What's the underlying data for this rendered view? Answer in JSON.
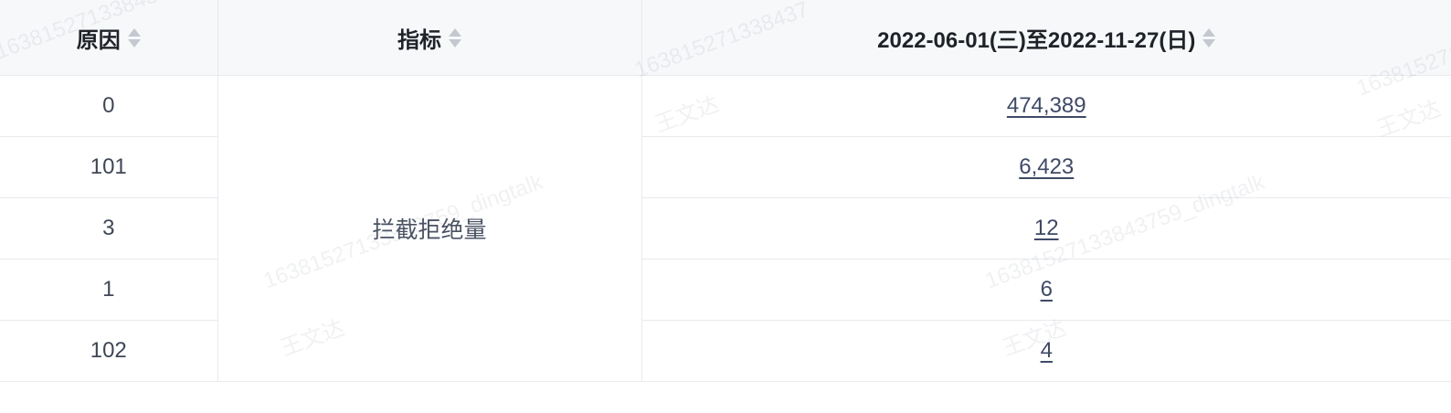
{
  "table": {
    "headers": {
      "reason": "原因",
      "metric": "指标",
      "date_range": "2022-06-01(三)至2022-11-27(日)"
    },
    "metric_name": "拦截拒绝量",
    "rows": [
      {
        "reason": "0",
        "value": "474,389"
      },
      {
        "reason": "101",
        "value": "6,423"
      },
      {
        "reason": "3",
        "value": "12"
      },
      {
        "reason": "1",
        "value": "6"
      },
      {
        "reason": "102",
        "value": "4"
      }
    ]
  },
  "watermark": {
    "id_text": "163815271338437",
    "id_dingtalk_text": "16381527133843759_dingtalk",
    "name_text": "王文达"
  }
}
